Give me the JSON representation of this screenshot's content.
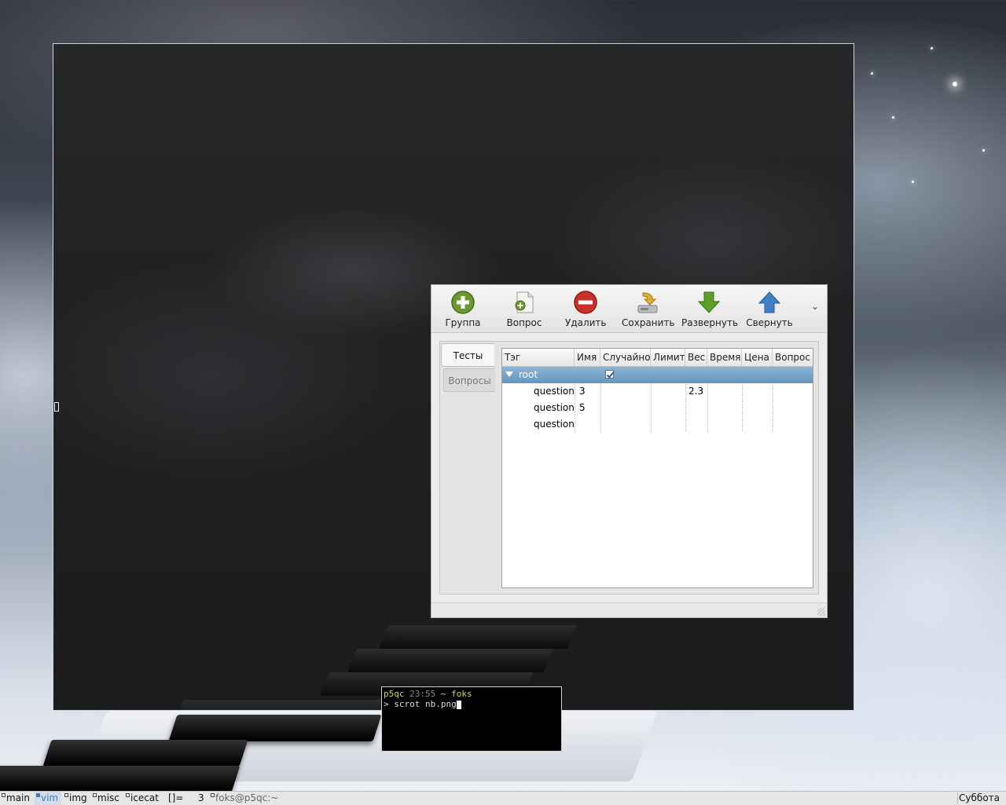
{
  "app": {
    "toolbar": {
      "group_label": "Группа",
      "question_label": "Вопрос",
      "delete_label": "Удалить",
      "save_label": "Сохранить",
      "expand_label": "Развернуть",
      "collapse_label": "Свернуть",
      "more_symbol": "⌄"
    },
    "tabs": [
      {
        "label": "Тесты"
      },
      {
        "label": "Вопросы"
      }
    ],
    "tree": {
      "columns": [
        "Тэг",
        "Имя",
        "Случайно",
        "Лимит",
        "Вес",
        "Время",
        "Цена",
        "Вопрос"
      ],
      "rows": [
        {
          "tag": "root",
          "name": "",
          "random_checked": true,
          "limit": "",
          "weight": "",
          "time": "",
          "price": "",
          "question": ""
        },
        {
          "tag": "question",
          "name": "3",
          "random_checked": false,
          "limit": "",
          "weight": "2.3",
          "time": "",
          "price": "",
          "question": ""
        },
        {
          "tag": "question",
          "name": "5",
          "random_checked": false,
          "limit": "",
          "weight": "",
          "time": "",
          "price": "",
          "question": ""
        },
        {
          "tag": "question",
          "name": "",
          "random_checked": false,
          "limit": "",
          "weight": "",
          "time": "",
          "price": "",
          "question": ""
        }
      ]
    }
  },
  "terminal": {
    "host": "p5qc",
    "time": "23:55",
    "path": "~",
    "user": "foks",
    "prompt": "> ",
    "command": "scrot nb.png"
  },
  "panel": {
    "workspaces": [
      {
        "label": "main",
        "active": false
      },
      {
        "label": "vim",
        "active": true
      },
      {
        "label": "img",
        "active": false
      },
      {
        "label": "misc",
        "active": false
      },
      {
        "label": "icecat",
        "active": false
      }
    ],
    "layout_symbol": "[]=",
    "window_count": "3",
    "window_title": "foks@p5qc:~",
    "clock": "Суббота"
  },
  "colors": {
    "selection": "#6795be",
    "panel_accent": "#4a79aa",
    "terminal_prompt": "#c9d84a"
  }
}
